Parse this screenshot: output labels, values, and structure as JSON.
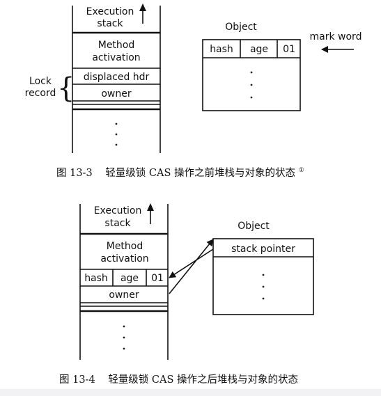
{
  "figure1": {
    "stack": {
      "header_line1": "Execution",
      "header_line2": "stack",
      "method_line1": "Method",
      "method_line2": "activation",
      "displaced": "displaced hdr",
      "owner": "owner"
    },
    "lock_record_line1": "Lock",
    "lock_record_line2": "record",
    "object": {
      "title": "Object",
      "fields": [
        "hash",
        "age",
        "01"
      ]
    },
    "mark_word": "mark word",
    "caption_prefix": "图 13-3",
    "caption_text": "轻量级锁 CAS 操作之前堆栈与对象的状态",
    "caption_note": "①"
  },
  "figure2": {
    "stack": {
      "header_line1": "Execution",
      "header_line2": "stack",
      "method_line1": "Method",
      "method_line2": "activation",
      "fields": [
        "hash",
        "age",
        "01"
      ],
      "owner": "owner"
    },
    "object": {
      "title": "Object",
      "stack_pointer": "stack pointer"
    },
    "caption_prefix": "图 13-4",
    "caption_text": "轻量级锁 CAS 操作之后堆栈与对象的状态"
  },
  "colors": {
    "ink": "#111111",
    "background": "#ffffff"
  }
}
